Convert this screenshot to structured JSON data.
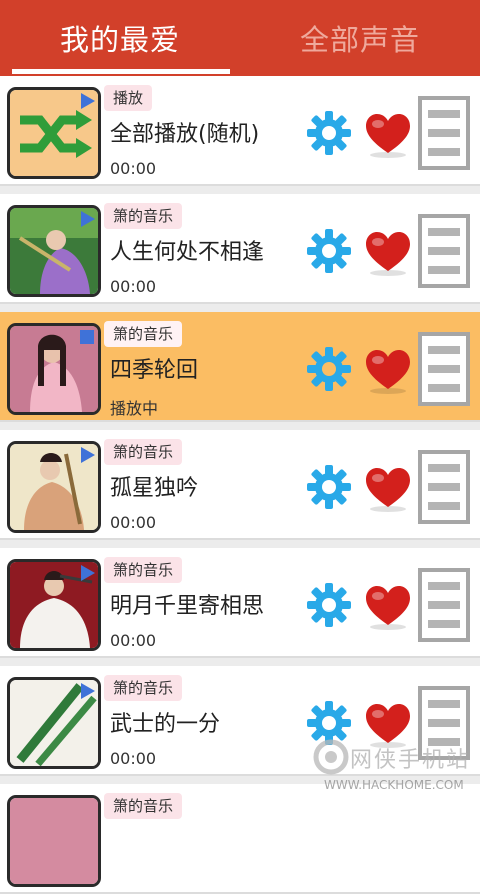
{
  "tabs": [
    {
      "label": "我的最爱",
      "active": true
    },
    {
      "label": "全部声音",
      "active": false
    }
  ],
  "colors": {
    "header": "#d2402a",
    "playing_row": "#fbbd63",
    "gear": "#29a9e8",
    "heart": "#d3201c"
  },
  "icons": {
    "settings": "gear-icon",
    "favorite": "heart-icon",
    "menu": "list-menu-icon",
    "play": "play-badge-icon"
  },
  "tracks": [
    {
      "tag": "播放",
      "title": "全部播放(随机)",
      "status": "00:00",
      "thumb": "shuffle"
    },
    {
      "tag": "箫的音乐",
      "title": "人生何处不相逢",
      "status": "00:00",
      "thumb": "green"
    },
    {
      "tag": "箫的音乐",
      "title": "四季轮回",
      "status": "播放中",
      "thumb": "pink",
      "playing": true
    },
    {
      "tag": "箫的音乐",
      "title": "孤星独吟",
      "status": "00:00",
      "thumb": "cream"
    },
    {
      "tag": "箫的音乐",
      "title": "明月千里寄相思",
      "status": "00:00",
      "thumb": "red"
    },
    {
      "tag": "箫的音乐",
      "title": "武士的一分",
      "status": "00:00",
      "thumb": "flute"
    },
    {
      "tag": "箫的音乐",
      "title": "",
      "status": "",
      "thumb": "pink"
    }
  ],
  "watermark": {
    "brand": "网侠手机站",
    "url": "WWW.HACKHOME.COM"
  }
}
